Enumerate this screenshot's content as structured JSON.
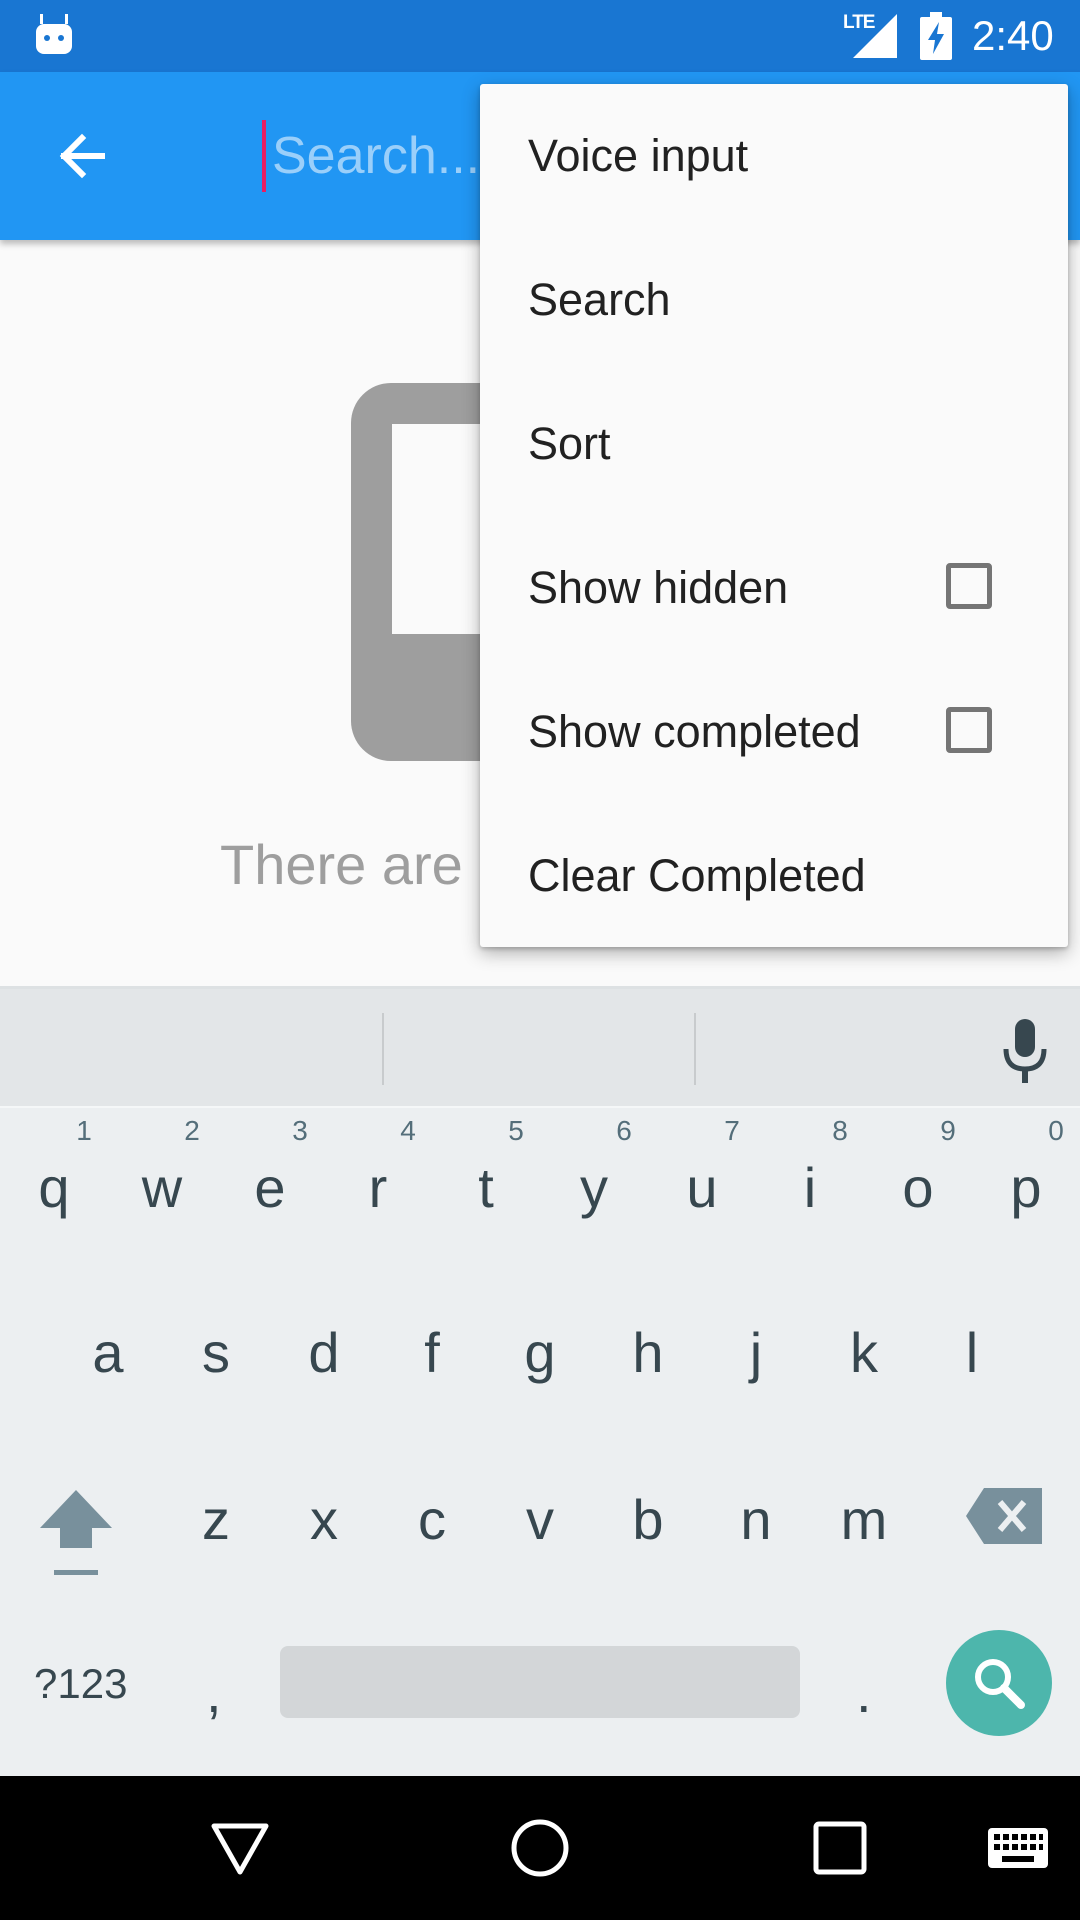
{
  "status_bar": {
    "network": "LTE",
    "time": "2:40",
    "icons": [
      "android-icon",
      "signal-icon",
      "battery-charging-icon"
    ]
  },
  "toolbar": {
    "search_placeholder": "Search...",
    "back_icon": "arrow-back-icon"
  },
  "content": {
    "empty_text": "There are"
  },
  "menu": {
    "items": [
      {
        "label": "Voice input"
      },
      {
        "label": "Search"
      },
      {
        "label": "Sort"
      },
      {
        "label": "Show hidden",
        "checked": false
      },
      {
        "label": "Show completed",
        "checked": false
      },
      {
        "label": "Clear Completed"
      }
    ]
  },
  "keyboard": {
    "row1": [
      "q",
      "w",
      "e",
      "r",
      "t",
      "y",
      "u",
      "i",
      "o",
      "p"
    ],
    "row1_hints": [
      "1",
      "2",
      "3",
      "4",
      "5",
      "6",
      "7",
      "8",
      "9",
      "0"
    ],
    "row2": [
      "a",
      "s",
      "d",
      "f",
      "g",
      "h",
      "j",
      "k",
      "l"
    ],
    "row3": [
      "z",
      "x",
      "c",
      "v",
      "b",
      "n",
      "m"
    ],
    "symbols_key": "?123",
    "comma_key": ",",
    "period_key": ".",
    "action_icon": "search-icon"
  },
  "nav_bar": {
    "icons": [
      "back-triangle-icon",
      "home-circle-icon",
      "recents-square-icon",
      "keyboard-icon"
    ]
  },
  "colors": {
    "status_bar": "#1976d2",
    "toolbar": "#2196f3",
    "cursor": "#e91e63",
    "search_key": "#4db6ac"
  }
}
